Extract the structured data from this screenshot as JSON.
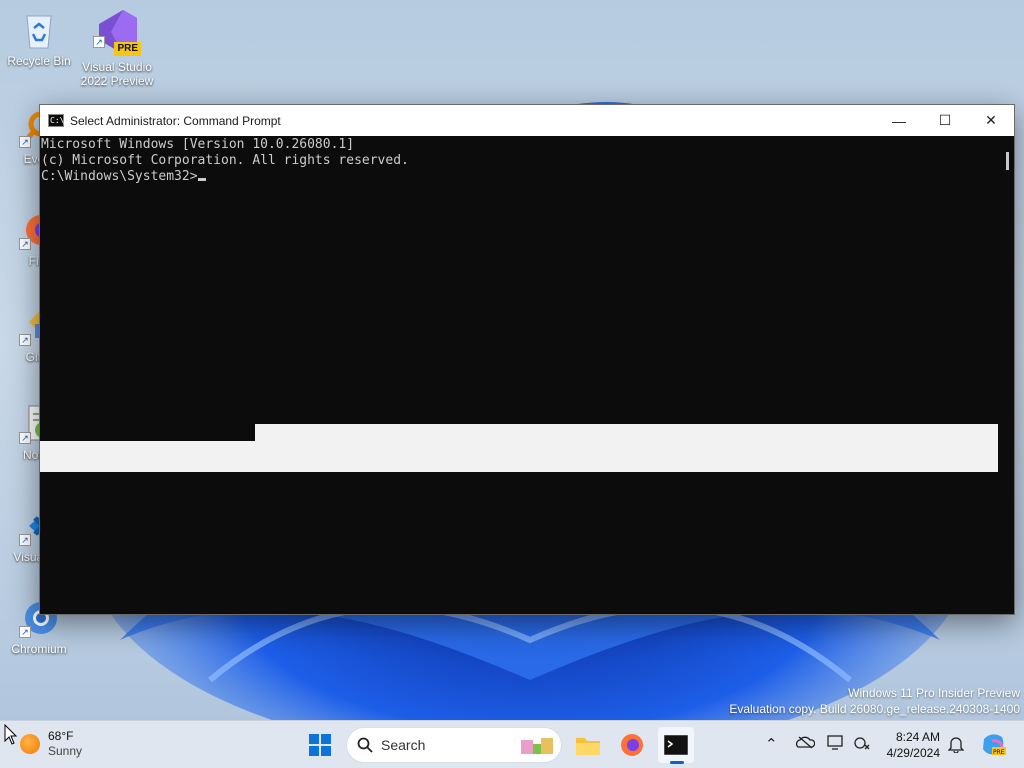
{
  "desktop": {
    "icons": [
      {
        "label": "Recycle Bin",
        "icon": "recycle-bin-icon"
      },
      {
        "label": "Visual Studio 2022 Preview",
        "icon": "visual-studio-icon",
        "badge": "PRE"
      },
      {
        "label": "Every",
        "icon": "everything-search-icon"
      },
      {
        "label": "Fire",
        "icon": "firefox-icon"
      },
      {
        "label": "Git B",
        "icon": "git-bash-icon"
      },
      {
        "label": "Notep",
        "icon": "notepad-plus-plus-icon"
      },
      {
        "label": "Visual Co",
        "icon": "vscode-icon"
      },
      {
        "label": "Chromium",
        "icon": "chromium-icon"
      }
    ]
  },
  "window": {
    "title": "Select Administrator: Command Prompt",
    "controls": {
      "minimize": "minimize-icon",
      "maximize": "maximize-icon",
      "close": "close-icon"
    },
    "console_lines": [
      "Microsoft Windows [Version 10.0.26080.1]",
      "(c) Microsoft Corporation. All rights reserved.",
      "",
      "C:\\Windows\\System32>"
    ]
  },
  "watermark": {
    "line1": "Windows 11 Pro Insider Preview",
    "line2": "Evaluation copy. Build 26080.ge_release.240308-1400"
  },
  "taskbar": {
    "weather": {
      "temp": "68°F",
      "condition": "Sunny"
    },
    "search_label": "Search",
    "apps": [
      "start-icon",
      "file-explorer-icon",
      "firefox-icon",
      "terminal-icon"
    ],
    "tray": [
      "chevron-up-icon",
      "onedrive-icon",
      "display-icon",
      "network-icon"
    ],
    "clock": {
      "time": "8:24 AM",
      "date": "4/29/2024"
    }
  },
  "colors": {
    "console_bg": "#0c0c0c",
    "console_text": "#cccccc",
    "accent": "#0a64c8"
  }
}
